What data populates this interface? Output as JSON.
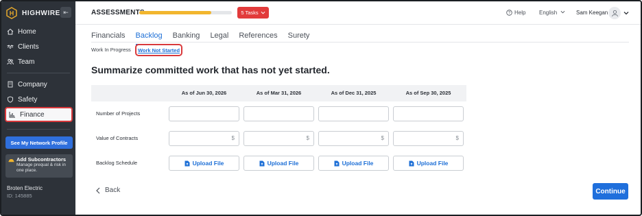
{
  "brand": {
    "name": "HIGHWIRE",
    "logo_letter": "H"
  },
  "sidebar": {
    "items": [
      {
        "label": "Home",
        "icon": "home-icon"
      },
      {
        "label": "Clients",
        "icon": "handshake-icon"
      },
      {
        "label": "Team",
        "icon": "people-icon"
      },
      {
        "label": "Company",
        "icon": "building-icon"
      },
      {
        "label": "Safety",
        "icon": "shield-icon"
      },
      {
        "label": "Finance",
        "icon": "chart-icon",
        "active": true
      }
    ],
    "network_button": "See My Network Profile",
    "promo": {
      "title": "Add Subcontractors",
      "text": "Manage prequal & risk in one place."
    },
    "company": {
      "name": "Broten Electric",
      "id": "ID: 145885"
    }
  },
  "topbar": {
    "title": "ASSESSMENTS",
    "progress": 0.78,
    "tasks_label": "5 Tasks",
    "help": "Help",
    "language": "English",
    "user": "Sam Keegan"
  },
  "tabs": [
    "Financials",
    "Backlog",
    "Banking",
    "Legal",
    "References",
    "Surety"
  ],
  "active_tab": "Backlog",
  "subtabs": [
    "Work In Progress",
    "Work Not Started"
  ],
  "active_subtab": "Work Not Started",
  "heading": "Summarize committed work that has not yet started.",
  "table": {
    "columns": [
      "As of Jun 30, 2026",
      "As of Mar 31, 2026",
      "As of Dec 31, 2025",
      "As of Sep 30, 2025"
    ],
    "rows": [
      {
        "label": "Number of Projects"
      },
      {
        "label": "Value of Contracts",
        "suffix": "$"
      },
      {
        "label": "Backlog Schedule",
        "button": "Upload File"
      }
    ]
  },
  "footer": {
    "back": "Back",
    "continue": "Continue"
  },
  "colors": {
    "primary": "#1f6fdc",
    "danger": "#e23b3b",
    "progress": "#f2b62e",
    "sidebar": "#2d3239",
    "highlight": "#d9393c"
  }
}
